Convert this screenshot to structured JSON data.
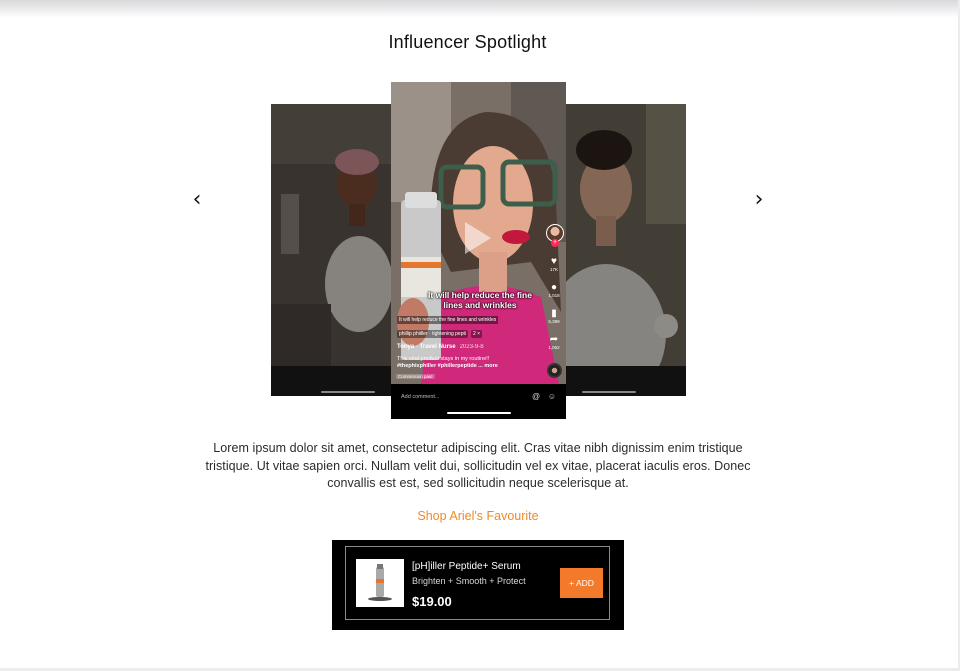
{
  "section": {
    "title": "Influencer Spotlight"
  },
  "carousel": {
    "prev_glyph": "‹",
    "next_glyph": "›",
    "main_video": {
      "caption": "It will help reduce the fine lines and wrinkles",
      "sticker": "It will help reduce the fine lines and wrinkles",
      "music": [
        "phillip phiiller · tightening pepti",
        "2 ×"
      ],
      "author": "Tonya · Travel Nurse",
      "date": "2023-9-8",
      "description": "This viral product stays in my routine!!",
      "hashtags": "#thephixphiller #phillerpeptide ... more",
      "commission": "Commission paid",
      "likes": "17K",
      "comments": "1,018",
      "saves": "5,399",
      "shares": "1,062",
      "comment_placeholder": "Add comment...",
      "comment_icons": [
        "at-icon",
        "emoji-icon"
      ]
    }
  },
  "body": {
    "text": "Lorem ipsum dolor sit amet, consectetur adipiscing elit. Cras vitae nibh dignissim enim tristique tristique. Ut vitae sapien orci. Nullam velit dui, sollicitudin vel ex vitae, placerat iaculis eros. Donec convallis est est, sed sollicitudin neque scelerisque at."
  },
  "shop": {
    "link_label": "Shop Ariel's Favourite"
  },
  "product": {
    "name": "[pH]iller Peptide+ Serum",
    "tagline": "Brighten + Smooth + Protect",
    "price": "$19.00",
    "add_label": "+ ADD"
  },
  "colors": {
    "accent": "#f08a24",
    "add_button": "#f47a2b",
    "card_bg": "#000000"
  }
}
